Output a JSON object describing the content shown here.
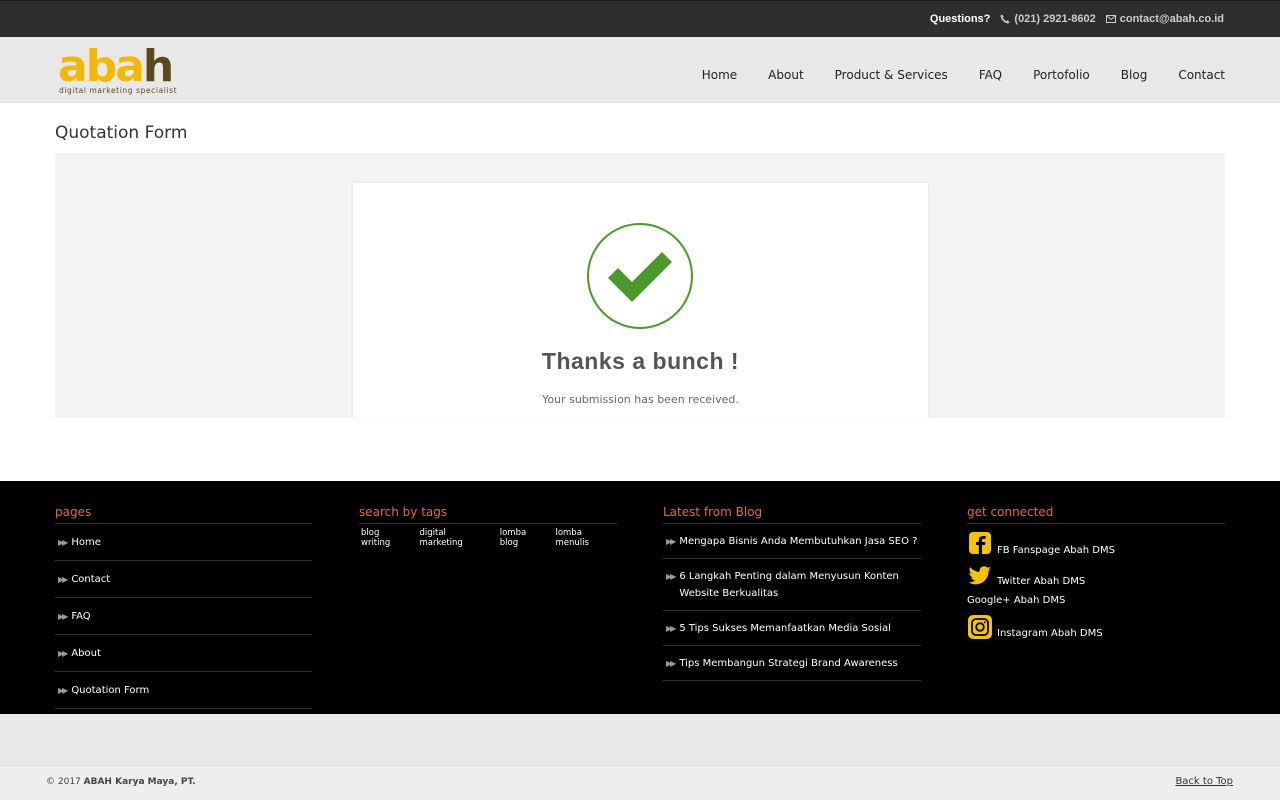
{
  "topbar": {
    "questions_label": "Questions?",
    "phone": "(021) 2921-8602",
    "email": "contact@abah.co.id"
  },
  "logo": {
    "letters": [
      "a",
      "b",
      "a",
      "h"
    ],
    "tagline": "digital marketing specialist"
  },
  "nav": [
    "Home",
    "About",
    "Product & Services",
    "FAQ",
    "Portofolio",
    "Blog",
    "Contact"
  ],
  "page": {
    "title": "Quotation Form"
  },
  "confirmation": {
    "title": "Thanks a bunch !",
    "message": "Your submission has been received.",
    "check_color": "#4a9a2c"
  },
  "footer": {
    "pages": {
      "heading": "pages",
      "items": [
        "Home",
        "Contact",
        "FAQ",
        "About",
        "Quotation Form"
      ]
    },
    "tags": {
      "heading": "search by tags",
      "items": [
        "blog writing",
        "digital marketing",
        "lomba blog",
        "lomba menulis"
      ]
    },
    "blog": {
      "heading": "Latest from Blog",
      "items": [
        "Mengapa Bisnis Anda Membutuhkan Jasa SEO ?",
        "6 Langkah Penting dalam Menyusun Konten Website Berkualitas",
        "5 Tips Sukses Memanfaatkan Media Sosial",
        "Tips Membangun Strategi Brand Awareness"
      ]
    },
    "social": {
      "heading": "get connected",
      "facebook": "FB Fanspage Abah DMS",
      "twitter": "Twitter Abah DMS",
      "googleplus": "Google+ Abah DMS",
      "instagram": "Instagram Abah DMS"
    }
  },
  "bottom": {
    "copyright_prefix": "© 2017",
    "company": "ABAH Karya Maya, PT.",
    "back_to_top": "Back to Top"
  },
  "colors": {
    "accent": "#e46a3c",
    "logo_yellow": "#f5b800",
    "logo_brown": "#5a4a1a",
    "icon_yellow": "#f5c400"
  }
}
